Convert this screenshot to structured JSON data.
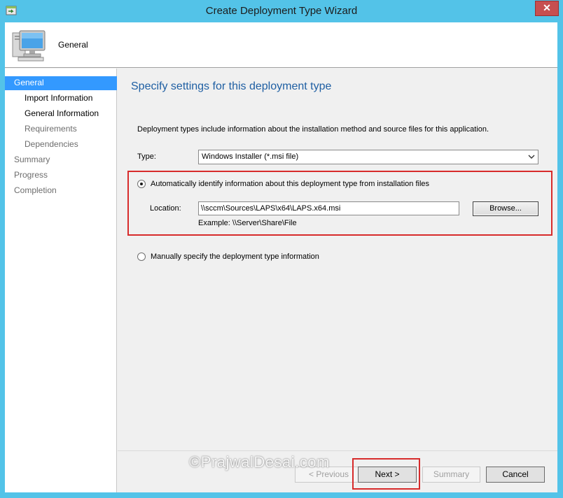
{
  "window": {
    "title": "Create Deployment Type Wizard",
    "close_glyph": "✕",
    "colors": {
      "frame": "#53c3e8",
      "close": "#c74f50",
      "selection": "#3399ff",
      "heading": "#1f5fa3",
      "highlight": "#d72b2b"
    }
  },
  "header": {
    "title": "General",
    "icon": "computer-icon"
  },
  "sidebar": {
    "items": [
      {
        "label": "General",
        "state": "selected"
      },
      {
        "label": "Import Information",
        "state": "sub-done"
      },
      {
        "label": "General Information",
        "state": "sub-done"
      },
      {
        "label": "Requirements",
        "state": "sub-pending"
      },
      {
        "label": "Dependencies",
        "state": "sub-pending"
      },
      {
        "label": "Summary",
        "state": "pending"
      },
      {
        "label": "Progress",
        "state": "pending"
      },
      {
        "label": "Completion",
        "state": "pending"
      }
    ]
  },
  "main": {
    "heading": "Specify settings for this deployment type",
    "description": "Deployment types include information about the installation method and source files for this application.",
    "type": {
      "label": "Type:",
      "selected": "Windows Installer (*.msi file)"
    },
    "auto_option": {
      "label": "Automatically identify information about this deployment type from installation files",
      "checked": true
    },
    "location": {
      "label": "Location:",
      "value": "\\\\sccm\\Sources\\LAPS\\x64\\LAPS.x64.msi",
      "browse_label": "Browse...",
      "example": "Example: \\\\Server\\Share\\File"
    },
    "manual_option": {
      "label": "Manually specify the deployment type information",
      "checked": false
    }
  },
  "footer": {
    "previous_label": "< Previous",
    "next_label": "Next >",
    "summary_label": "Summary",
    "cancel_label": "Cancel"
  },
  "watermark": "©PrajwalDesai.com"
}
